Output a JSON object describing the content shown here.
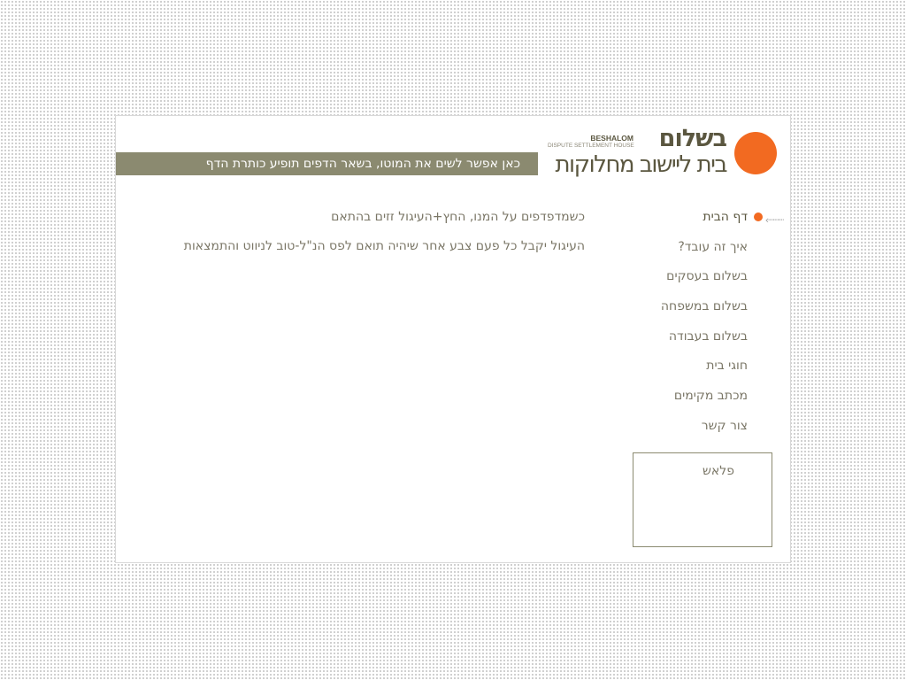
{
  "logo": {
    "name": "בשלום",
    "latin": "BESHALOM",
    "latin_subtitle": "DISPUTE SETTLEMENT HOUSE",
    "tagline": "בית ליישוב מחלוקות"
  },
  "motto_bar": {
    "text": "כאן אפשר לשים את המוטו, בשאר הדפים תופיע  כותרת הדף"
  },
  "nav": {
    "items": [
      {
        "label": "דף הבית"
      },
      {
        "label": "איך זה עובד?"
      },
      {
        "label": "בשלום בעסקים"
      },
      {
        "label": "בשלום במשפחה"
      },
      {
        "label": "בשלום בעבודה"
      },
      {
        "label": "חוגי בית"
      },
      {
        "label": "מכתב מקימים"
      },
      {
        "label": "צור קשר"
      }
    ],
    "active_index": 0,
    "active_arrow": "‹┈┈┈"
  },
  "content": {
    "line1": "כשמדפדפים על המנו,  החץ+העיגול זזים בהתאם",
    "line2": "העיגול יקבל כל פעם צבע אחר שיהיה תואם לפס הנ\"ל-טוב לניווט והתמצאות"
  },
  "flash": {
    "label": "פלאש"
  },
  "colors": {
    "accent": "#f26a21",
    "olive": "#8b8a70",
    "text": "#7a7666",
    "logo_text": "#5b5740"
  }
}
